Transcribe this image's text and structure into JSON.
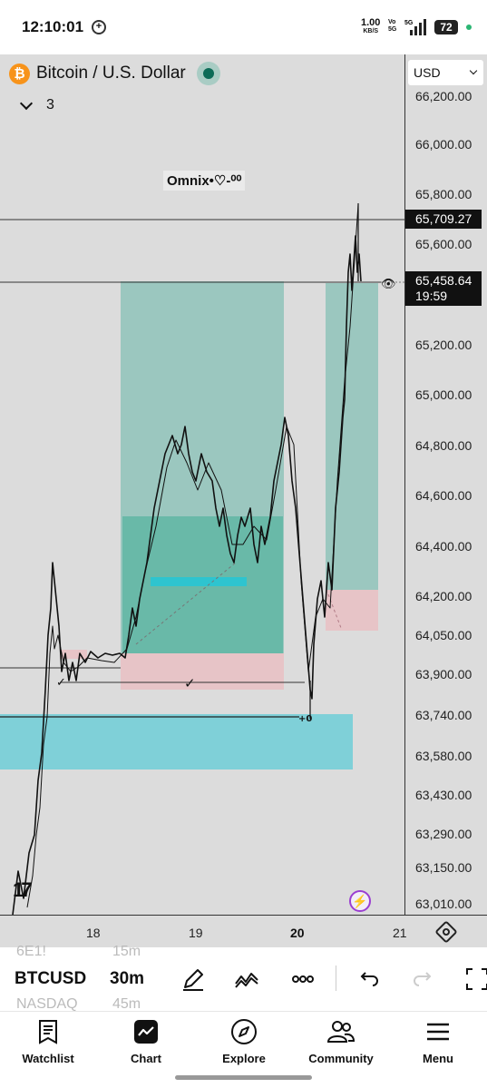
{
  "status": {
    "time": "12:10:01",
    "net_speed": "1.00",
    "net_unit": "KB/S",
    "vo_top": "Vo",
    "vo_bottom": "5G",
    "net_type": "5G",
    "battery": "72"
  },
  "chart": {
    "symbol_title": "Bitcoin / U.S. Dollar",
    "collapsed_count": "3",
    "watermark": "Omnix•♡-⁰⁰",
    "currency": "USD",
    "price_ticks": [
      "66,200.00",
      "66,000.00",
      "65,800.00",
      "65,600.00",
      "65,200.00",
      "65,000.00",
      "64,800.00",
      "64,600.00",
      "64,400.00",
      "64,200.00",
      "64,050.00",
      "63,900.00",
      "63,740.00",
      "63,580.00",
      "63,430.00",
      "63,290.00",
      "63,150.00",
      "63,010.00"
    ],
    "marker_price": "65,709.27",
    "last_price": "65,458.64",
    "countdown": "19:59",
    "time_ticks": [
      "18",
      "19",
      "20",
      "21"
    ],
    "colors": {
      "background": "#dcdcdc",
      "long_zone": "#9bc7bf",
      "long_zone_deep": "#69b9a8",
      "loss_zone": "#e7c4c7",
      "support_zone": "#7fd0d8",
      "accent": "#2ec4cf"
    }
  },
  "toolbar": {
    "symbol": "BTCUSD",
    "interval": "30m",
    "ghost_prev_symbol": "6E1!",
    "ghost_next_symbol": "NASDAQ",
    "ghost_prev_interval": "15m",
    "ghost_next_interval": "45m"
  },
  "nav": {
    "items": [
      {
        "label": "Watchlist",
        "icon": "watchlist-icon"
      },
      {
        "label": "Chart",
        "icon": "chart-icon"
      },
      {
        "label": "Explore",
        "icon": "compass-icon"
      },
      {
        "label": "Community",
        "icon": "community-icon"
      },
      {
        "label": "Menu",
        "icon": "menu-icon"
      }
    ]
  }
}
